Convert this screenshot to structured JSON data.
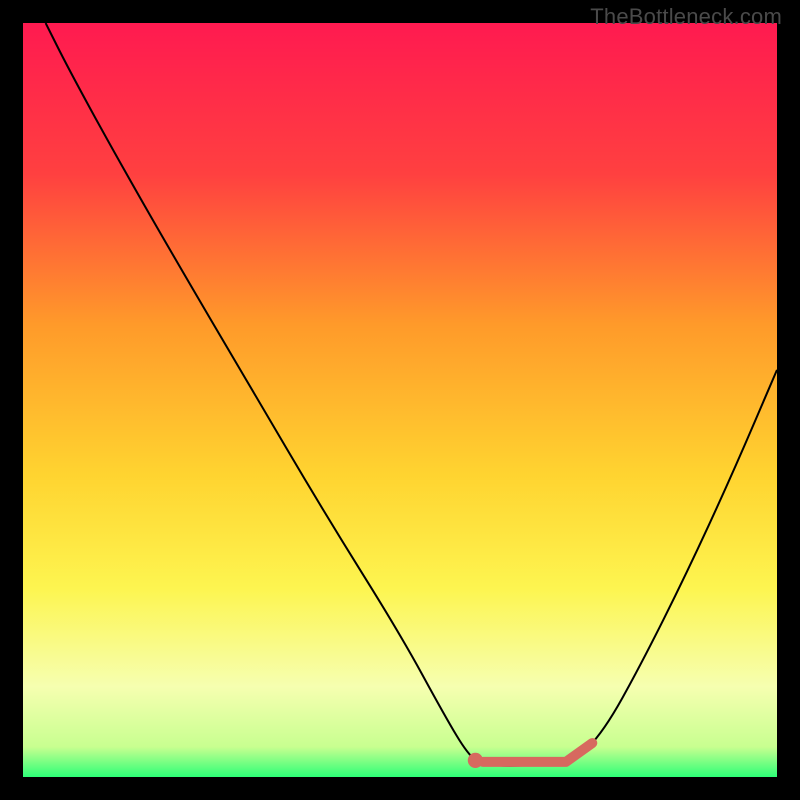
{
  "watermark": "TheBottleneck.com",
  "chart_data": {
    "type": "line",
    "title": "",
    "xlabel": "",
    "ylabel": "",
    "xlim": [
      0,
      100
    ],
    "ylim": [
      0,
      100
    ],
    "background_gradient": {
      "stops": [
        {
          "offset": 0,
          "color": "#ff1a50"
        },
        {
          "offset": 20,
          "color": "#ff4040"
        },
        {
          "offset": 40,
          "color": "#ff9a2a"
        },
        {
          "offset": 60,
          "color": "#ffd430"
        },
        {
          "offset": 75,
          "color": "#fdf550"
        },
        {
          "offset": 88,
          "color": "#f6ffb0"
        },
        {
          "offset": 96,
          "color": "#c8ff90"
        },
        {
          "offset": 100,
          "color": "#2dff77"
        }
      ]
    },
    "series": [
      {
        "name": "curve",
        "color": "#000000",
        "stroke_width": 2,
        "points": [
          {
            "x": 3,
            "y": 100
          },
          {
            "x": 6,
            "y": 94
          },
          {
            "x": 12,
            "y": 83
          },
          {
            "x": 20,
            "y": 69
          },
          {
            "x": 30,
            "y": 52
          },
          {
            "x": 40,
            "y": 35
          },
          {
            "x": 50,
            "y": 19
          },
          {
            "x": 56,
            "y": 8
          },
          {
            "x": 59,
            "y": 3
          },
          {
            "x": 61,
            "y": 1.5
          },
          {
            "x": 68,
            "y": 1.5
          },
          {
            "x": 73,
            "y": 2
          },
          {
            "x": 77,
            "y": 6
          },
          {
            "x": 82,
            "y": 15
          },
          {
            "x": 88,
            "y": 27
          },
          {
            "x": 94,
            "y": 40
          },
          {
            "x": 100,
            "y": 54
          }
        ]
      },
      {
        "name": "marker-strip",
        "color": "#d7695f",
        "stroke_width": 10,
        "points": [
          {
            "x": 61,
            "y": 2
          },
          {
            "x": 72,
            "y": 2
          },
          {
            "x": 75.5,
            "y": 4.5
          }
        ],
        "dot": {
          "x": 60,
          "y": 2.2,
          "r": 4
        }
      }
    ]
  }
}
